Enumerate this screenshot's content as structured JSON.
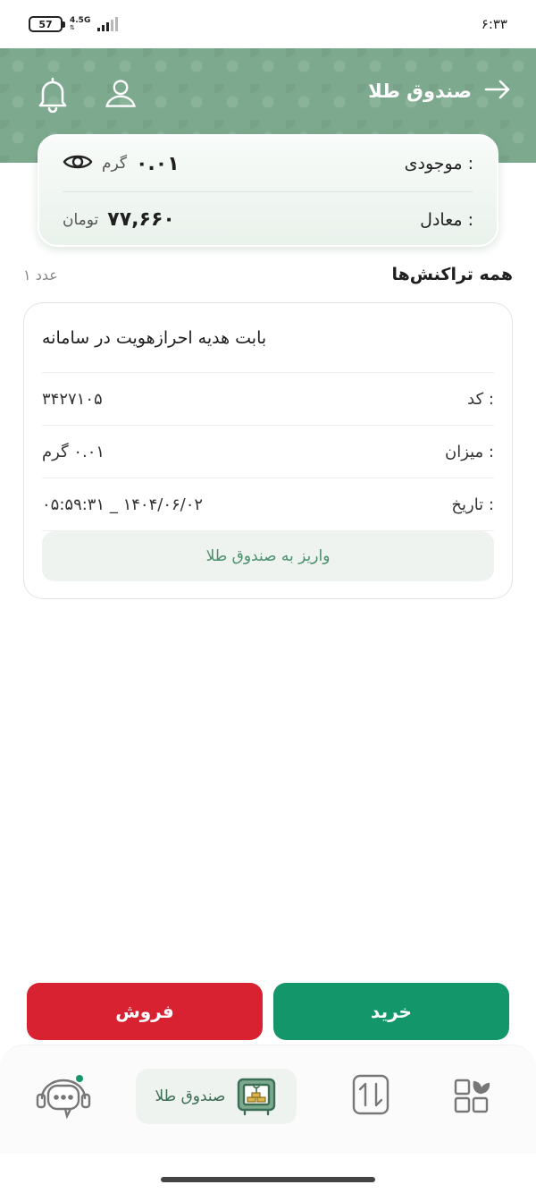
{
  "status_bar": {
    "time": "۶:۳۳",
    "battery": "57",
    "network": "4.5G"
  },
  "header": {
    "title": "صندوق طلا",
    "icons": {
      "back": "arrow-right-icon",
      "profile": "user-icon",
      "notifications": "bell-icon"
    }
  },
  "balance": {
    "stock_label": "موجودی :",
    "stock_value": "۰.۰۱",
    "stock_unit": "گرم",
    "equivalent_label": "معادل :",
    "equivalent_value": "۷۷,۶۶۰",
    "equivalent_unit": "تومان"
  },
  "transactions": {
    "title": "همه تراکنش‌ها",
    "count": "۱ عدد",
    "items": [
      {
        "description": "بابت هدیه احرازهویت در سامانه",
        "code_label": "کد :",
        "code": "۳۴۲۷۱۰۵",
        "amount_label": "میزان :",
        "amount": "۰.۰۱ گرم",
        "date_label": "تاریخ :",
        "date": "۱۴۰۴/۰۶/۰۲ _ ۰۵:۵۹:۳۱",
        "status": "واریز به صندوق طلا"
      }
    ]
  },
  "actions": {
    "sell": "فروش",
    "buy": "خرید"
  },
  "nav": {
    "gold_fund": "صندوق طلا",
    "icons": {
      "support": "support-chat-icon",
      "gold": "gold-box-icon",
      "transfer": "transfer-icon",
      "apps": "apps-grid-icon"
    }
  },
  "colors": {
    "header_green": "#7daa8f",
    "buy_green": "#12966a",
    "sell_red": "#d92231",
    "status_green": "#4a8f6b"
  }
}
